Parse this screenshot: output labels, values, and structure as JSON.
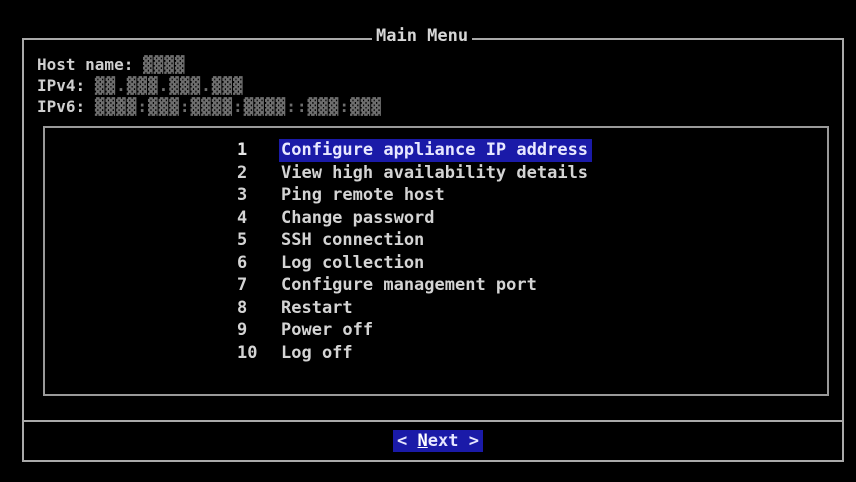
{
  "dialog": {
    "title": "Main Menu"
  },
  "host": {
    "host_name_label": "Host name:",
    "host_name_value": "▓▓▓▓",
    "ipv4_label": "IPv4:",
    "ipv4_value": "▓▓.▓▓▓.▓▓▓.▓▓▓",
    "ipv6_label": "IPv6:",
    "ipv6_value": "▓▓▓▓:▓▓▓:▓▓▓▓:▓▓▓▓::▓▓▓:▓▓▓"
  },
  "menu": {
    "items": [
      {
        "num": "1",
        "label": "Configure appliance IP address",
        "selected": true
      },
      {
        "num": "2",
        "label": "View high availability details"
      },
      {
        "num": "3",
        "label": "Ping remote host"
      },
      {
        "num": "4",
        "label": "Change password"
      },
      {
        "num": "5",
        "label": "SSH connection"
      },
      {
        "num": "6",
        "label": "Log collection"
      },
      {
        "num": "7",
        "label": "Configure management port"
      },
      {
        "num": "8",
        "label": "Restart"
      },
      {
        "num": "9",
        "label": "Power off"
      },
      {
        "num": "10",
        "label": "Log off"
      }
    ]
  },
  "buttons": {
    "next_left": "< ",
    "next_hotkey": "N",
    "next_rest": "ext >"
  },
  "colors": {
    "background": "#000000",
    "highlight": "#1a1aa8",
    "text": "#d4d4d4",
    "border": "#a9a9a9"
  }
}
